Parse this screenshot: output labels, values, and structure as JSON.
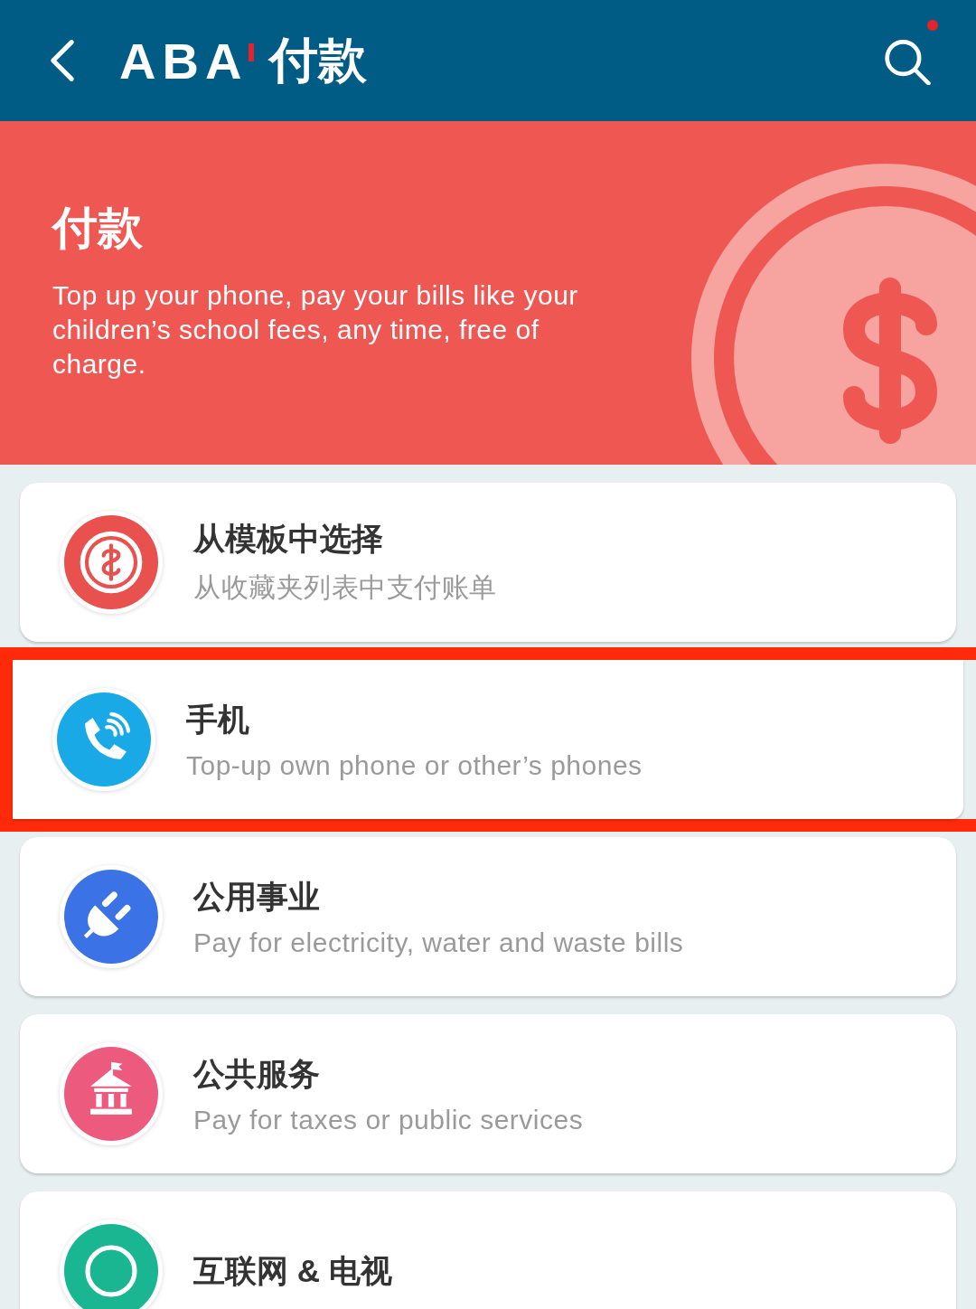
{
  "header": {
    "logo": "ABA",
    "title": "付款",
    "notification_dot": true
  },
  "banner": {
    "title": "付款",
    "text": "Top up your phone, pay your bills like your children’s school fees, any time, free of charge."
  },
  "items": [
    {
      "kind": "coin",
      "color": "#e9514f",
      "title": "从模板中选择",
      "subtitle": "从收藏夹列表中支付账单",
      "highlighted": false
    },
    {
      "kind": "phone",
      "color": "#18a9e6",
      "title": "手机",
      "subtitle": "Top-up own phone or other’s phones",
      "highlighted": true
    },
    {
      "kind": "plug",
      "color": "#3b73e6",
      "title": "公用事业",
      "subtitle": "Pay for electricity, water and waste bills",
      "highlighted": false
    },
    {
      "kind": "bank",
      "color": "#ec5a7e",
      "title": "公共服务",
      "subtitle": "Pay for taxes or public services",
      "highlighted": false
    },
    {
      "kind": "globe",
      "color": "#1ab591",
      "title": "互联网 & 电视",
      "highlighted": false
    }
  ]
}
